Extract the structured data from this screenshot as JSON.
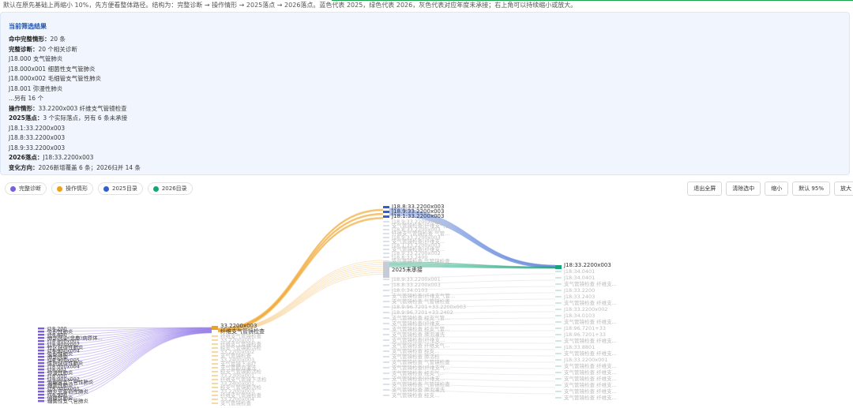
{
  "hint": "默认在原先基础上再缩小 10%，先方便看整体路径。结构为：完整诊断 → 操作情形 → 2025落点 → 2026落点。蓝色代表 2025，绿色代表 2026，灰色代表对应年度未承接；右上角可以持续缩小或放大。",
  "summary": {
    "title": "当前筛选结果",
    "lines": [
      {
        "label": "命中完整情形：",
        "value": "20 条"
      },
      {
        "label": "完整诊断：",
        "value": "20 个相关诊断"
      },
      {
        "label": "",
        "value": "J18.000 支气管肺炎"
      },
      {
        "label": "",
        "value": "J18.000x001 细菌性支气管肺炎"
      },
      {
        "label": "",
        "value": "J18.000x002 毛细管支气管性肺炎"
      },
      {
        "label": "",
        "value": "J18.001 弥漫性肺炎"
      },
      {
        "label": "",
        "value": "...另有 16 个"
      },
      {
        "label": "操作情形：",
        "value": "33.2200x003 纤维支气管镜检查"
      },
      {
        "label": "2025落点：",
        "value": "3 个实际落点，另有 6 条未承接"
      },
      {
        "label": "",
        "value": "J18.1:33.2200x003"
      },
      {
        "label": "",
        "value": "J18.8:33.2200x003"
      },
      {
        "label": "",
        "value": "J18.9:33.2200x003"
      },
      {
        "label": "2026落点：",
        "value": "J18:33.2200x003"
      },
      {
        "label": "变化方向：",
        "value": "2026新增覆盖 6 条；2026归并 14 条"
      }
    ]
  },
  "legend": [
    {
      "label": "完整诊断",
      "color": "#7c5ce6"
    },
    {
      "label": "操作情形",
      "color": "#f0a020"
    },
    {
      "label": "2025目录",
      "color": "#2f5fd0"
    },
    {
      "label": "2026目录",
      "color": "#1aa37a"
    }
  ],
  "buttons": {
    "exit_fullscreen": "退出全屏",
    "clear_selection": "清除选中",
    "zoom_out": "缩小",
    "default_zoom": "默认 95%",
    "zoom_in": "放大"
  },
  "sankey": {
    "col1": [
      "J18.200",
      "坠积性肺炎",
      "J18.800",
      "肺部感染(非典)病原体...",
      "J18.800x001",
      "J18.800x002",
      "社区获得性肺炎",
      "J18.900x004",
      "坠积性肺炎",
      "肺部感染",
      "J18.900x005",
      "医院获得性肺炎",
      "J18.000x004",
      "J18.001",
      "弥漫性肺炎",
      "J18.000",
      "J18.000x002",
      "毛细管支气管性肺炎",
      "细菌性肺炎",
      "J18.000x001",
      "肺炎克雷伯性肺炎",
      "J18.900",
      "间质性肺炎",
      "细菌性支气管肺炎"
    ],
    "col2_head": [
      "33.2200x003",
      "纤维支气管镜检查"
    ],
    "col2_faint": [
      "纤维支气管镜检查",
      "33.2200x001",
      "纤维支气管镜检查",
      "经支气管镜肺活检",
      "33.2200x002",
      "支气管镜检查",
      "33.2400x003",
      "支气管镜下治疗",
      "支气管肺泡灌洗",
      "经支气管镜肺活检",
      "33.2300x001",
      "纤维支气管镜下活检",
      "33.2400x001",
      "经支气管镜肺活检",
      "33.2200x003",
      "纤维支气管镜检查",
      "33.2200x004",
      "支气管镜检查"
    ],
    "col3_head": [
      "J18.8:33.2200x003",
      "J18.9:33.2200x003",
      "J18.1:33.2200x003"
    ],
    "col3_faint1": [
      "J18.9:33.2200x003",
      "支气管镜检查(纤维支气管...",
      "J18.8:33.2200x003",
      "纤维支气管镜检查 气管...",
      "J18.9:33.2200x003",
      "支气管镜检查(纤维支...",
      "J18.1:33.2200x003",
      "支气管镜检查(纤维支...",
      "J18.9:33.2200x002",
      "J18.8:33.2400",
      "支气管镜检查 气管镜检查"
    ],
    "col3_unmatched": "2025未承接",
    "col3_faint2": [
      "J18.9:33.2200x001",
      "J18.8:33.2200x003",
      "J18.0:34.0103",
      "支气管镜检查(纤维支气管...",
      "支气管镜检查 气管镜检查",
      "J18.9:96.7201+33.2200x003",
      "J18.9:96.7201+33.2402",
      "支气管镜检查 经支气管...",
      "支气管镜检查(纤维支...",
      "支气管镜检查 经支气管...",
      "支气管镜检查 肺泡灌洗",
      "支气管镜检查(纤维支...",
      "支气管镜检查 纤维支气...",
      "支气管镜检查 经支...",
      "支气管镜检查 肺活检",
      "支气管镜检查 气管镜检查",
      "支气管镜检查(纤维支气...",
      "支气管镜检查 经支气...",
      "支气管镜检查(纤维支...",
      "支气管镜检查 气管镜检查",
      "支气管镜检查 肺泡灌洗",
      "支气管镜检查 经支..."
    ],
    "col4_head": "J18:33.2200x003",
    "col4_faint": [
      "J18:34.0401",
      "J18:34.0401",
      "支气管镜检查 纤维支...",
      "J18:33.2200",
      "J18:33.2403",
      "支气管镜检查 纤维支...",
      "J18:33.2200x002",
      "J18:34.0103",
      "支气管镜检查 纤维支...",
      "J18:96.7201+33",
      "J18:96.7201+33",
      "支气管镜检查 纤维支...",
      "J18:33.8801",
      "支气管镜检查 纤维支...",
      "J18:33.2200x001",
      "支气管镜检查 纤维支...",
      "支气管镜检查 纤维支...",
      "支气管镜检查 纤维支...",
      "支气管镜检查 纤维支...",
      "支气管镜检查 纤维支...",
      "支气管镜检查 纤维支..."
    ]
  }
}
